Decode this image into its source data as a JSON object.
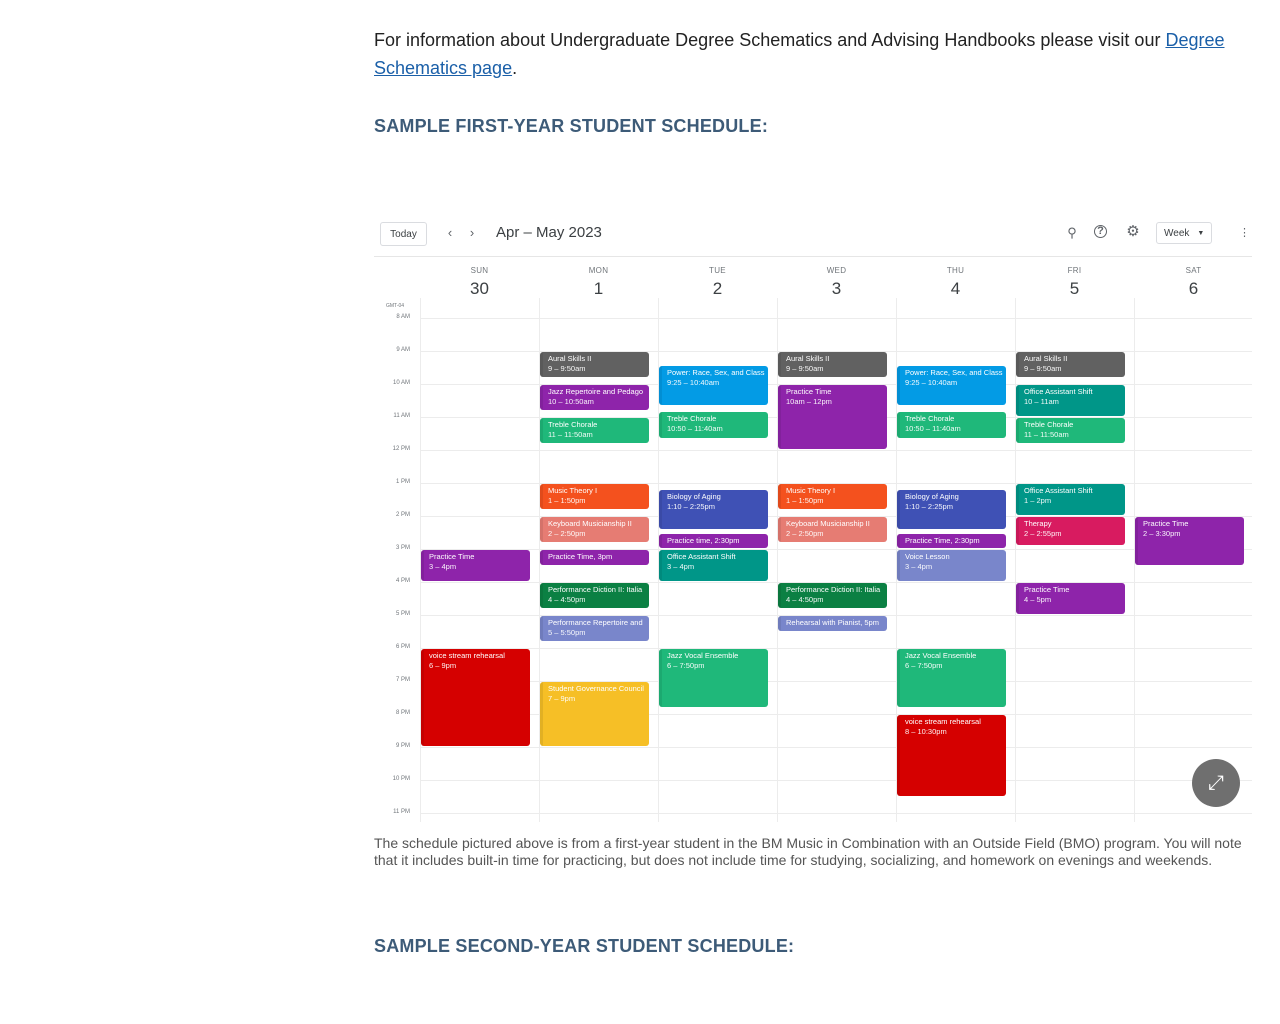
{
  "intro": {
    "text_before": "For information about Undergraduate Degree Schematics and Advising Handbooks please visit our ",
    "link_text": "Degree Schematics page",
    "text_after": "."
  },
  "headings": {
    "first_year": "SAMPLE FIRST-YEAR STUDENT SCHEDULE:",
    "second_year": "SAMPLE SECOND-YEAR STUDENT SCHEDULE:"
  },
  "calendar": {
    "today_label": "Today",
    "prev_icon": "chevron-left-icon",
    "next_icon": "chevron-right-icon",
    "date_range": "Apr – May 2023",
    "view_label": "Week",
    "timezone": "GMT-04",
    "days": [
      {
        "name": "SUN",
        "date": "30"
      },
      {
        "name": "MON",
        "date": "1"
      },
      {
        "name": "TUE",
        "date": "2"
      },
      {
        "name": "WED",
        "date": "3"
      },
      {
        "name": "THU",
        "date": "4"
      },
      {
        "name": "FRI",
        "date": "5"
      },
      {
        "name": "SAT",
        "date": "6"
      }
    ],
    "hours": [
      "8 AM",
      "9 AM",
      "10 AM",
      "11 AM",
      "12 PM",
      "1 PM",
      "2 PM",
      "3 PM",
      "4 PM",
      "5 PM",
      "6 PM",
      "7 PM",
      "8 PM",
      "9 PM",
      "10 PM",
      "11 PM"
    ],
    "colors": {
      "graphite": "#616161",
      "purple": "#8e24aa",
      "peacock": "#039be5",
      "basil": "#0b8043",
      "sage": "#33b679",
      "tangerine": "#f4511e",
      "flamingo": "#e67c73",
      "blueberry": "#3f51b5",
      "lavender": "#7986cb",
      "teal": "#009688",
      "tomato": "#d50000",
      "banana": "#f6bf26",
      "grape": "#8e24aa",
      "cherry": "#d81b60"
    },
    "events": [
      {
        "day": 0,
        "start": 15,
        "end": 16,
        "title": "Practice Time",
        "time": "3 – 4pm",
        "color": "#8e24aa"
      },
      {
        "day": 0,
        "start": 18,
        "end": 21,
        "title": "voice stream rehearsal",
        "time": "6 – 9pm",
        "color": "#d50000"
      },
      {
        "day": 1,
        "start": 9,
        "end": 9.833,
        "title": "Aural Skills II",
        "time": "9 – 9:50am",
        "color": "#616161"
      },
      {
        "day": 1,
        "start": 10,
        "end": 10.833,
        "title": "Jazz Repertoire and Pedago",
        "time": "10 – 10:50am",
        "color": "#8e24aa"
      },
      {
        "day": 1,
        "start": 11,
        "end": 11.833,
        "title": "Treble Chorale",
        "time": "11 – 11:50am",
        "color": "#1fb87a"
      },
      {
        "day": 1,
        "start": 13,
        "end": 13.833,
        "title": "Music Theory I",
        "time": "1 – 1:50pm",
        "color": "#f4511e"
      },
      {
        "day": 1,
        "start": 14,
        "end": 14.833,
        "title": "Keyboard Musicianship II",
        "time": "2 – 2:50pm",
        "color": "#e67c73"
      },
      {
        "day": 1,
        "start": 15,
        "end": 15.5,
        "title": "Practice Time, 3pm",
        "time": "",
        "color": "#8e24aa"
      },
      {
        "day": 1,
        "start": 16,
        "end": 16.833,
        "title": "Performance Diction II: Italia",
        "time": "4 – 4:50pm",
        "color": "#0b8043"
      },
      {
        "day": 1,
        "start": 17,
        "end": 17.833,
        "title": "Performance Repertoire and",
        "time": "5 – 5:50pm",
        "color": "#7986cb"
      },
      {
        "day": 1,
        "start": 19,
        "end": 21,
        "title": "Student Governance Council",
        "time": "7 – 9pm",
        "color": "#f6bf26"
      },
      {
        "day": 2,
        "start": 9.417,
        "end": 10.667,
        "title": "Power: Race, Sex, and Class",
        "time": "9:25 – 10:40am",
        "color": "#039be5"
      },
      {
        "day": 2,
        "start": 10.833,
        "end": 11.667,
        "title": "Treble Chorale",
        "time": "10:50 – 11:40am",
        "color": "#1fb87a"
      },
      {
        "day": 2,
        "start": 13.167,
        "end": 14.417,
        "title": "Biology of Aging",
        "time": "1:10 – 2:25pm",
        "color": "#3f51b5"
      },
      {
        "day": 2,
        "start": 14.5,
        "end": 15,
        "title": "Practice time, 2:30pm",
        "time": "",
        "color": "#8e24aa"
      },
      {
        "day": 2,
        "start": 15,
        "end": 16,
        "title": "Office Assistant Shift",
        "time": "3 – 4pm",
        "color": "#009688"
      },
      {
        "day": 2,
        "start": 18,
        "end": 19.833,
        "title": "Jazz Vocal Ensemble",
        "time": "6 – 7:50pm",
        "color": "#1fb87a"
      },
      {
        "day": 3,
        "start": 9,
        "end": 9.833,
        "title": "Aural Skills II",
        "time": "9 – 9:50am",
        "color": "#616161"
      },
      {
        "day": 3,
        "start": 10,
        "end": 12,
        "title": "Practice Time",
        "time": "10am – 12pm",
        "color": "#8e24aa"
      },
      {
        "day": 3,
        "start": 13,
        "end": 13.833,
        "title": "Music Theory I",
        "time": "1 – 1:50pm",
        "color": "#f4511e"
      },
      {
        "day": 3,
        "start": 14,
        "end": 14.833,
        "title": "Keyboard Musicianship II",
        "time": "2 – 2:50pm",
        "color": "#e67c73"
      },
      {
        "day": 3,
        "start": 16,
        "end": 16.833,
        "title": "Performance Diction II: Italia",
        "time": "4 – 4:50pm",
        "color": "#0b8043"
      },
      {
        "day": 3,
        "start": 17,
        "end": 17.5,
        "title": "Rehearsal with Pianist, 5pm",
        "time": "",
        "color": "#7986cb"
      },
      {
        "day": 4,
        "start": 9.417,
        "end": 10.667,
        "title": "Power: Race, Sex, and Class",
        "time": "9:25 – 10:40am",
        "color": "#039be5"
      },
      {
        "day": 4,
        "start": 10.833,
        "end": 11.667,
        "title": "Treble Chorale",
        "time": "10:50 – 11:40am",
        "color": "#1fb87a"
      },
      {
        "day": 4,
        "start": 13.167,
        "end": 14.417,
        "title": "Biology of Aging",
        "time": "1:10 – 2:25pm",
        "color": "#3f51b5"
      },
      {
        "day": 4,
        "start": 14.5,
        "end": 15,
        "title": "Practice Time, 2:30pm",
        "time": "",
        "color": "#8e24aa"
      },
      {
        "day": 4,
        "start": 15,
        "end": 16,
        "title": "Voice Lesson",
        "time": "3 – 4pm",
        "color": "#7986cb"
      },
      {
        "day": 4,
        "start": 18,
        "end": 19.833,
        "title": "Jazz Vocal Ensemble",
        "time": "6 – 7:50pm",
        "color": "#1fb87a"
      },
      {
        "day": 4,
        "start": 20,
        "end": 22.5,
        "title": "voice stream rehearsal",
        "time": "8 – 10:30pm",
        "color": "#d50000"
      },
      {
        "day": 5,
        "start": 9,
        "end": 9.833,
        "title": "Aural Skills II",
        "time": "9 – 9:50am",
        "color": "#616161"
      },
      {
        "day": 5,
        "start": 10,
        "end": 11,
        "title": "Office Assistant Shift",
        "time": "10 – 11am",
        "color": "#009688"
      },
      {
        "day": 5,
        "start": 11,
        "end": 11.833,
        "title": "Treble Chorale",
        "time": "11 – 11:50am",
        "color": "#1fb87a"
      },
      {
        "day": 5,
        "start": 13,
        "end": 14,
        "title": "Office Assistant Shift",
        "time": "1 – 2pm",
        "color": "#009688"
      },
      {
        "day": 5,
        "start": 14,
        "end": 14.917,
        "title": "Therapy",
        "time": "2 – 2:55pm",
        "color": "#d81b60"
      },
      {
        "day": 5,
        "start": 16,
        "end": 17,
        "title": "Practice Time",
        "time": "4 – 5pm",
        "color": "#8e24aa"
      },
      {
        "day": 6,
        "start": 14,
        "end": 15.5,
        "title": "Practice Time",
        "time": "2 – 3:30pm",
        "color": "#8e24aa"
      }
    ]
  },
  "caption": "The schedule pictured above is from a first-year student in the BM Music in Combination with an Outside Field (BMO) program.  You will note that it includes built-in time for practicing, but does not include time for studying, socializing, and homework on evenings and weekends."
}
